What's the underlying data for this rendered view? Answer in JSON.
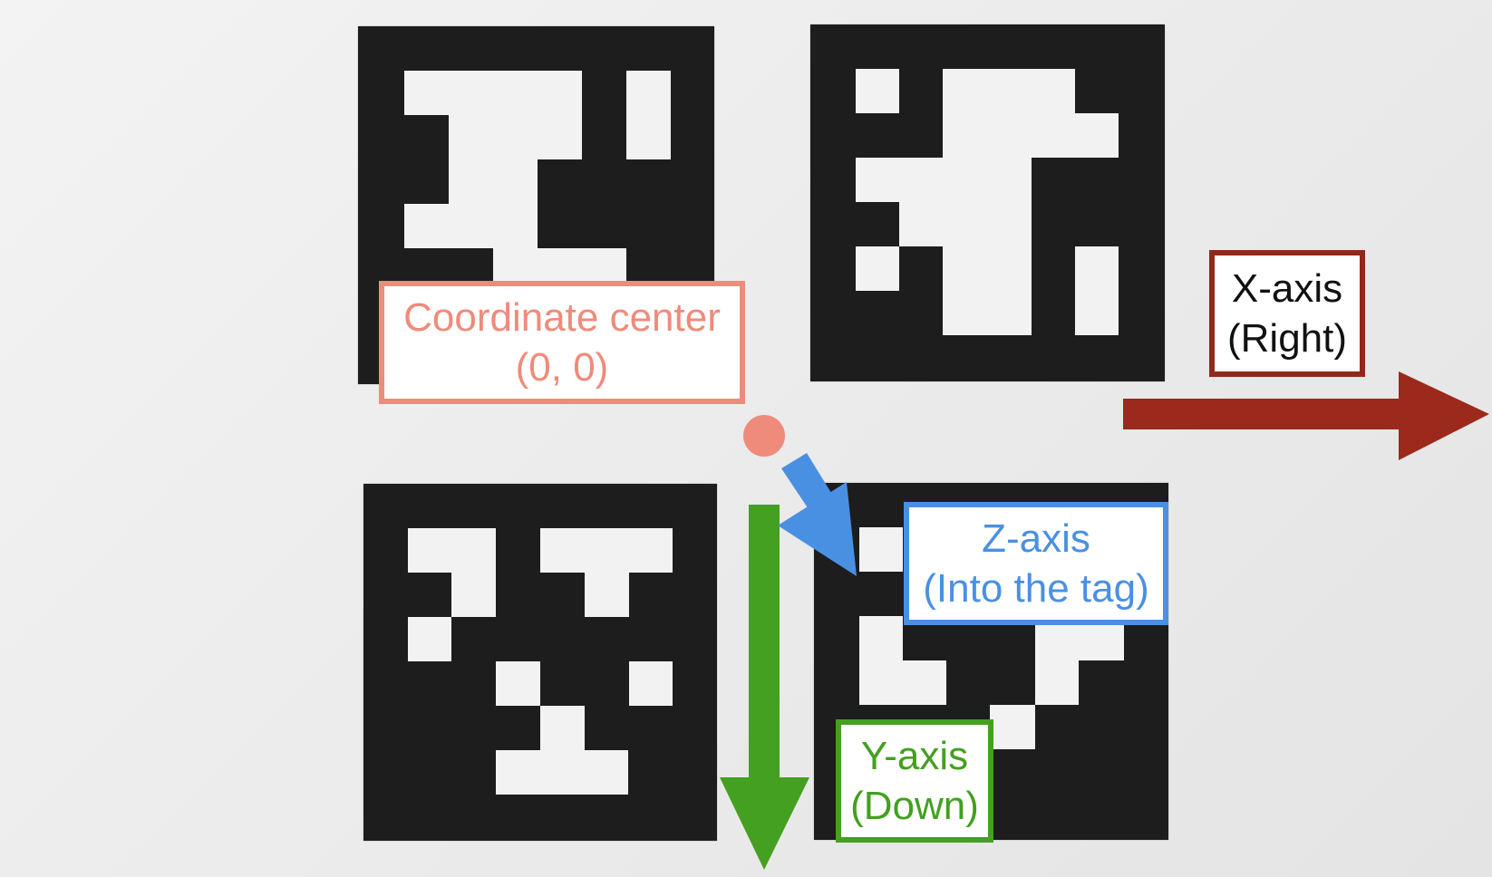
{
  "labels": {
    "origin": {
      "line1": "Coordinate center",
      "line2": "(0, 0)",
      "color": "#ef8b7b"
    },
    "x_axis": {
      "line1": "X-axis",
      "line2": "(Right)",
      "color": "#8e2a1c"
    },
    "y_axis": {
      "line1": "Y-axis",
      "line2": "(Down)",
      "color": "#43a020"
    },
    "z_axis": {
      "line1": "Z-axis",
      "line2": "(Into the tag)",
      "color": "#4a90e2"
    }
  },
  "colors": {
    "tag_black": "#1d1d1d",
    "paper": "#eeeeee",
    "origin_dot": "#ef8b7b"
  }
}
